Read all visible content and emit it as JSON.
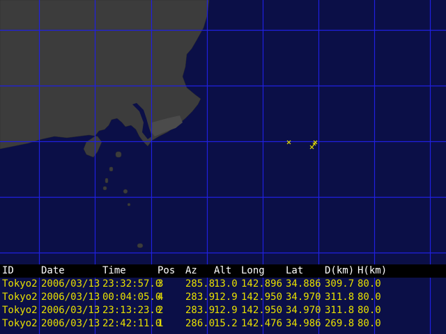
{
  "table": {
    "headers": [
      "ID",
      "Date",
      "Time",
      "Pos",
      "Az",
      "Alt",
      "Long",
      "Lat",
      "D(km)",
      "H(km)"
    ],
    "rows": [
      [
        "Tokyo2",
        "2006/03/13",
        "23:32:57.0",
        "3",
        "285.8",
        "13.0",
        "142.896",
        "34.886",
        "309.7",
        "80.0"
      ],
      [
        "Tokyo2",
        "2006/03/13",
        "00:04:05.0",
        "4",
        "283.9",
        "12.9",
        "142.950",
        "34.970",
        "311.8",
        "80.0"
      ],
      [
        "Tokyo2",
        "2006/03/13",
        "23:13:23.0",
        "2",
        "283.9",
        "12.9",
        "142.950",
        "34.970",
        "311.8",
        "80.0"
      ],
      [
        "Tokyo2",
        "2006/03/13",
        "22:42:11.0",
        "1",
        "286.0",
        "15.2",
        "142.476",
        "34.986",
        "269.8",
        "80.0"
      ]
    ]
  },
  "colors": {
    "ocean": "#0b0f47",
    "grid": "#2020e0",
    "land": "#3c3c3c",
    "marker": "#e8e000",
    "data_text": "#e8e000",
    "header_text": "#ffffff"
  },
  "markers": {
    "count": 4,
    "symbol": "×"
  }
}
